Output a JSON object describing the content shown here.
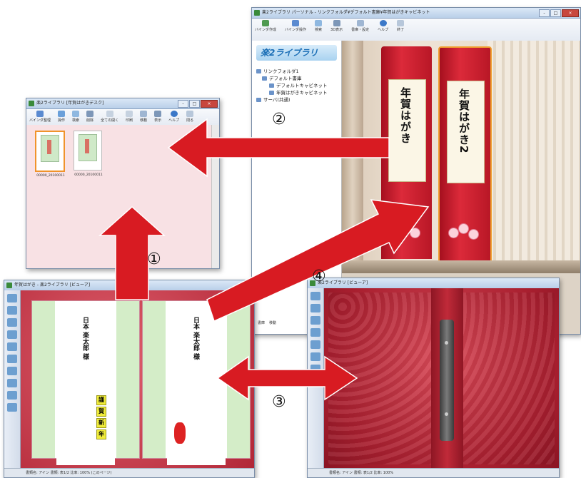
{
  "desk_window": {
    "title": "楽2ライブラリ [年賀はがきデスク]",
    "toolbar": [
      "バインダ整理",
      "操作",
      "検索",
      "削除",
      "全ての開く",
      "印刷",
      "移動",
      "表示",
      "ヘルプ",
      "閉る"
    ],
    "thumbs": [
      {
        "caption": "00000_20100011"
      },
      {
        "caption": "00000_20100011"
      }
    ]
  },
  "cabinet_window": {
    "title": "楽2ライブラリ パーソナル - リンクフォルダ¥デフォルト書庫¥年賀はがきキャビネット",
    "toolbar": [
      "バインダ作成",
      "バインダ操作",
      "検索",
      "3D表示",
      "書庫・設定",
      "ヘルプ",
      "終了"
    ],
    "logo": "楽2ライブラリ",
    "tree": [
      "リンクフォルダ1",
      "デフォルト書庫",
      "デフォルトキャビネット",
      "年賀はがきキャビネット",
      "サーバ(共通)"
    ],
    "binders": [
      "年賀はがき",
      "年賀はがき2"
    ],
    "bottom_buttons": [
      "書庫",
      "移動"
    ]
  },
  "viewer_open": {
    "title": "年賀はがき - 楽2ライブラリ [ビューア]",
    "status": "書類名: アイン 書類: 表1/2 比率: 100% (このページ)",
    "left_card": {
      "name": "日本 楽太郎 様"
    },
    "right_card": {
      "name": "日本 楽太郎 様"
    },
    "greeting": [
      "謹",
      "賀",
      "新",
      "年"
    ]
  },
  "viewer_closed": {
    "title": "楽2ライブラリ [ビューア]",
    "status": "書類名: アイン 書類: 表1/2 比率: 100%"
  },
  "annotations": {
    "n1": "①",
    "n2": "②",
    "n3": "③",
    "n4": "④"
  },
  "colors": {
    "arrow": "#d81b22",
    "book": "#c12a3a"
  }
}
